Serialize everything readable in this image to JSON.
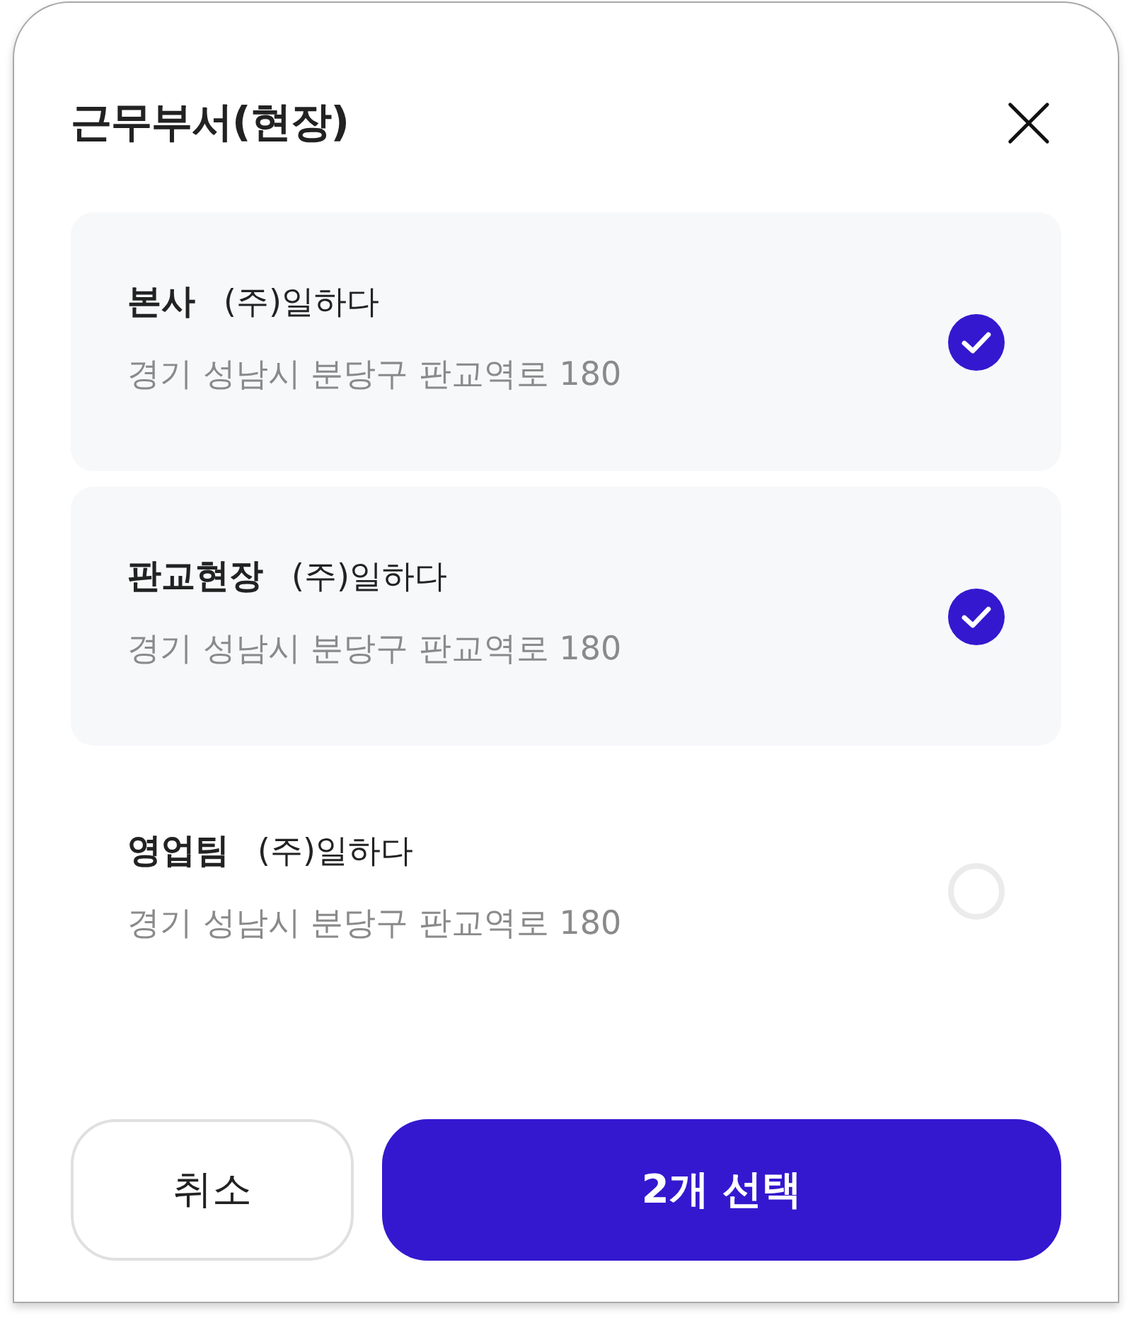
{
  "dialog": {
    "title": "근무부서(현장)"
  },
  "items": [
    {
      "name": "본사",
      "company": "(주)일하다",
      "address": "경기 성남시 분당구 판교역로 180",
      "selected": true
    },
    {
      "name": "판교현장",
      "company": "(주)일하다",
      "address": "경기 성남시 분당구 판교역로 180",
      "selected": true
    },
    {
      "name": "영업팀",
      "company": "(주)일하다",
      "address": "경기 성남시 분당구 판교역로 180",
      "selected": false
    }
  ],
  "buttons": {
    "cancel": "취소",
    "confirm": "2개 선택"
  }
}
